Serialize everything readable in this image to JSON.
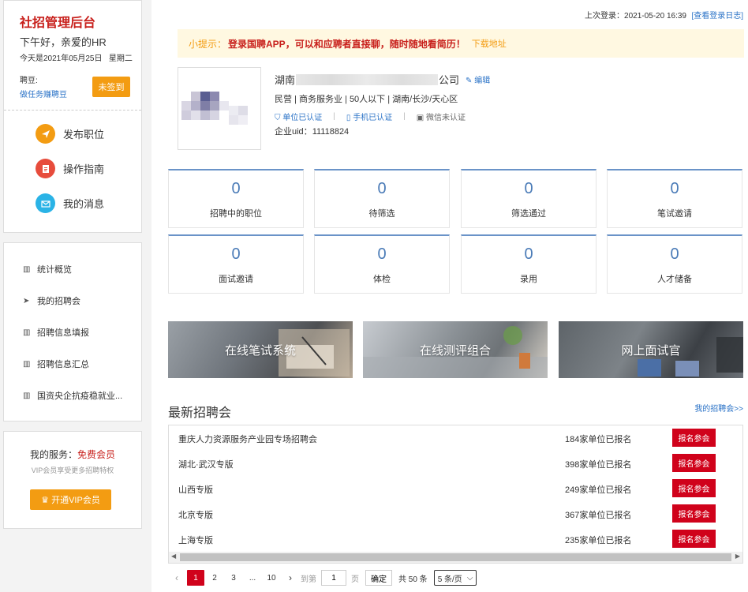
{
  "sidebar": {
    "brand": "社招管理后台",
    "greeting": "下午好，亲爱的HR",
    "date": "今天是2021年05月25日",
    "weekday": "星期二",
    "bean_label": "聘豆:",
    "bean_link": "做任务赚聘豆",
    "signin_label": "未签到",
    "quick": [
      {
        "label": "发布职位",
        "icon": "send-icon",
        "color": "#f39c12"
      },
      {
        "label": "操作指南",
        "icon": "document-icon",
        "color": "#e74c3c"
      },
      {
        "label": "我的消息",
        "icon": "mail-icon",
        "color": "#2ab3e6"
      }
    ],
    "menu": [
      {
        "label": "统计概览",
        "icon": "bar-chart-icon"
      },
      {
        "label": "我的招聘会",
        "icon": "paper-plane-icon"
      },
      {
        "label": "招聘信息填报",
        "icon": "bar-chart-icon"
      },
      {
        "label": "招聘信息汇总",
        "icon": "bar-chart-icon"
      },
      {
        "label": "国资央企抗疫稳就业...",
        "icon": "bar-chart-icon"
      }
    ],
    "service": {
      "prefix": "我的服务：",
      "level": "免费会员",
      "subtitle": "VIP会员享受更多招聘特权",
      "vip_button": "开通VIP会员"
    }
  },
  "header": {
    "last_login_label": "上次登录：",
    "last_login_time": "2021-05-20 16:39",
    "login_log_link": "[查看登录日志]"
  },
  "tip": {
    "prefix": "小提示：",
    "message": "登录国聘APP，可以和应聘者直接聊，随时随地看简历！",
    "download_link": "下载地址"
  },
  "company": {
    "name_prefix": "湖南",
    "name_suffix": "公司",
    "edit_label": "编辑",
    "info": "民营 | 商务服务业 | 50人以下 | 湖南/长沙/天心区",
    "badges": [
      "单位已认证",
      "手机已认证",
      "微信未认证"
    ],
    "uid_label": "企业uid：",
    "uid": "11118824"
  },
  "stats": [
    {
      "value": "0",
      "label": "招聘中的职位"
    },
    {
      "value": "0",
      "label": "待筛选"
    },
    {
      "value": "0",
      "label": "筛选通过"
    },
    {
      "value": "0",
      "label": "笔试邀请"
    },
    {
      "value": "0",
      "label": "面试邀请"
    },
    {
      "value": "0",
      "label": "体检"
    },
    {
      "value": "0",
      "label": "录用"
    },
    {
      "value": "0",
      "label": "人才储备"
    }
  ],
  "cards": [
    {
      "label": "在线笔试系统"
    },
    {
      "label": "在线测评组合"
    },
    {
      "label": "网上面试官"
    }
  ],
  "fairs": {
    "title": "最新招聘会",
    "more_link": "我的招聘会>>",
    "join_label": "报名参会",
    "rows": [
      {
        "name": "重庆人力资源服务产业园专场招聘会",
        "count": "184家单位已报名"
      },
      {
        "name": "湖北·武汉专版",
        "count": "398家单位已报名"
      },
      {
        "name": "山西专版",
        "count": "249家单位已报名"
      },
      {
        "name": "北京专版",
        "count": "367家单位已报名"
      },
      {
        "name": "上海专版",
        "count": "235家单位已报名"
      }
    ]
  },
  "pagination": {
    "pages": [
      "1",
      "2",
      "3",
      "...",
      "10"
    ],
    "jump_label": "到第",
    "jump_value": "1",
    "page_unit": "页",
    "confirm": "确定",
    "total": "共 50 条",
    "page_size": "5 条/页"
  }
}
